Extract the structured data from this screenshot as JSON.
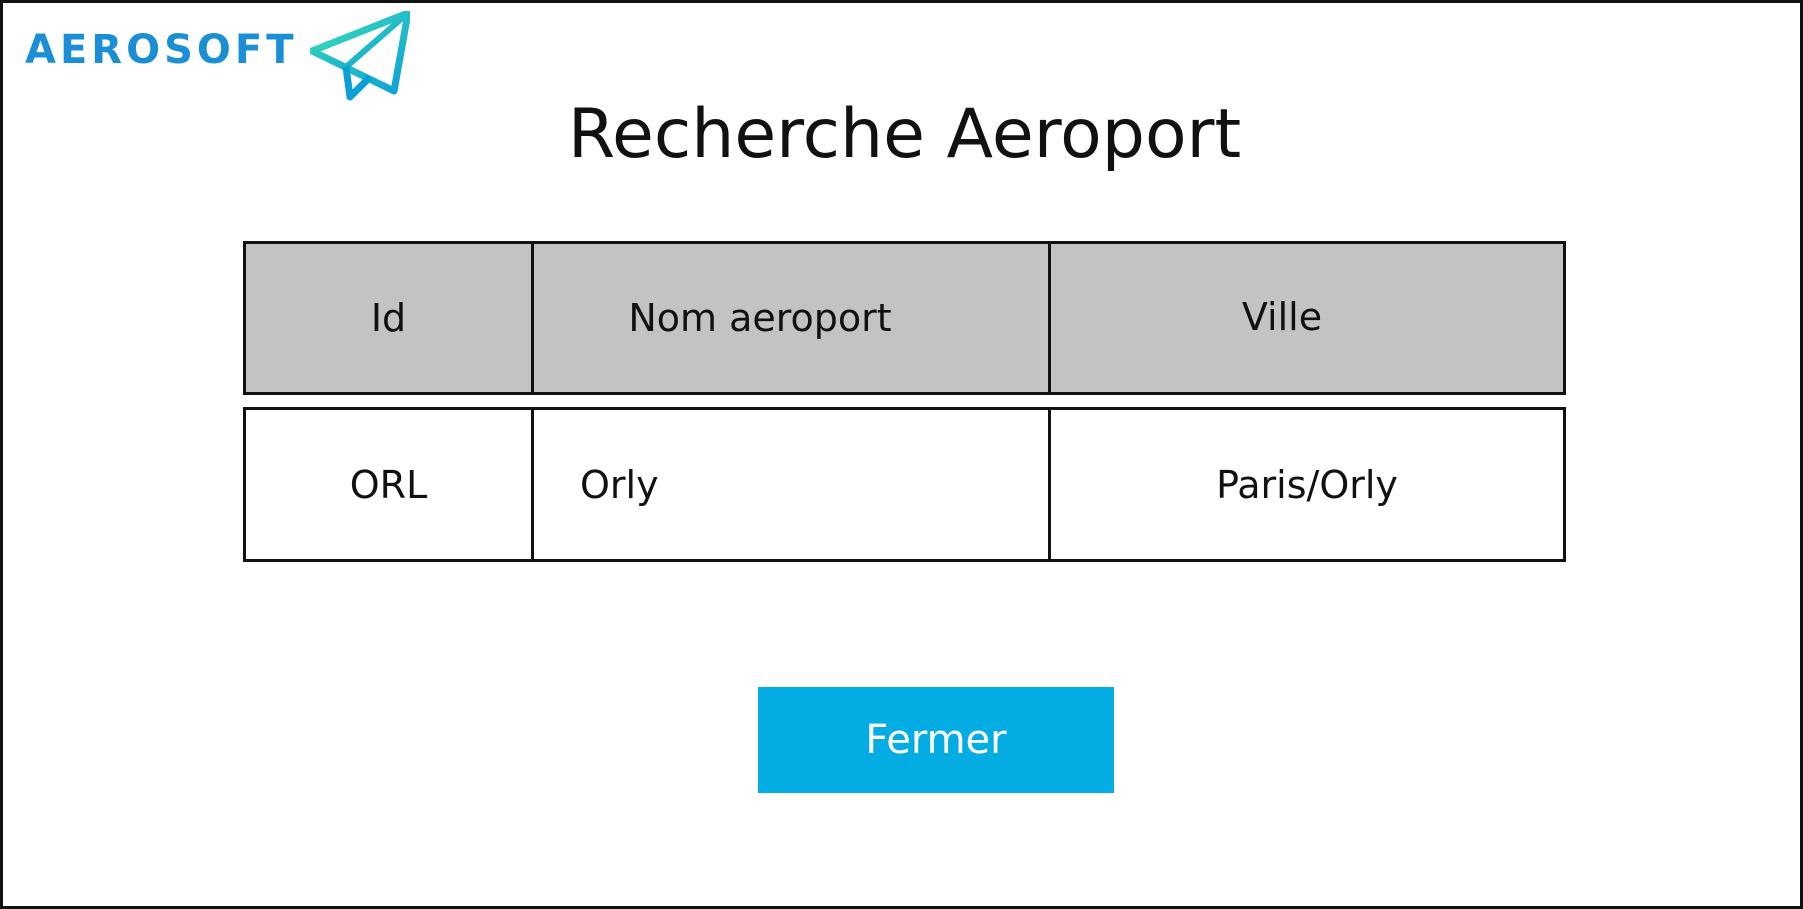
{
  "brand": {
    "name": "AEROSOFT",
    "logo_icon": "paper-plane-icon",
    "colors": {
      "text": "#1b8fd6",
      "plane_light": "#3ee0b5",
      "plane_dark": "#0b9fd8"
    }
  },
  "page": {
    "title": "Recherche Aeroport"
  },
  "table": {
    "headers": [
      "Id",
      "Nom aeroport",
      "Ville"
    ],
    "rows": [
      [
        "ORL",
        "Orly",
        "Paris/Orly"
      ]
    ],
    "header_bg": "#c3c3c3"
  },
  "actions": {
    "close_label": "Fermer",
    "close_color": "#03ade3"
  }
}
